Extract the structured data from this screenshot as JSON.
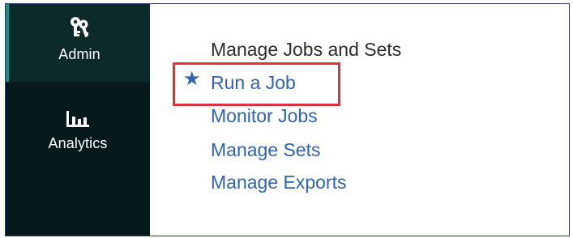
{
  "sidebar": {
    "items": [
      {
        "label": "Admin",
        "icon": "admin-keys-icon",
        "active": true
      },
      {
        "label": "Analytics",
        "icon": "bar-chart-icon",
        "active": false
      }
    ]
  },
  "menu": {
    "heading": "Manage Jobs and Sets",
    "favorite_icon": "star",
    "links": [
      {
        "label": "Run a Job",
        "favorite": true,
        "highlighted": true
      },
      {
        "label": "Monitor Jobs"
      },
      {
        "label": "Manage Sets"
      },
      {
        "label": "Manage Exports"
      }
    ]
  },
  "colors": {
    "sidebar_bg": "#061a1b",
    "active_item_bg": "#0c2a29",
    "active_accent": "#1f8a84",
    "link": "#2f63ad",
    "highlight_box": "#e0303a"
  }
}
